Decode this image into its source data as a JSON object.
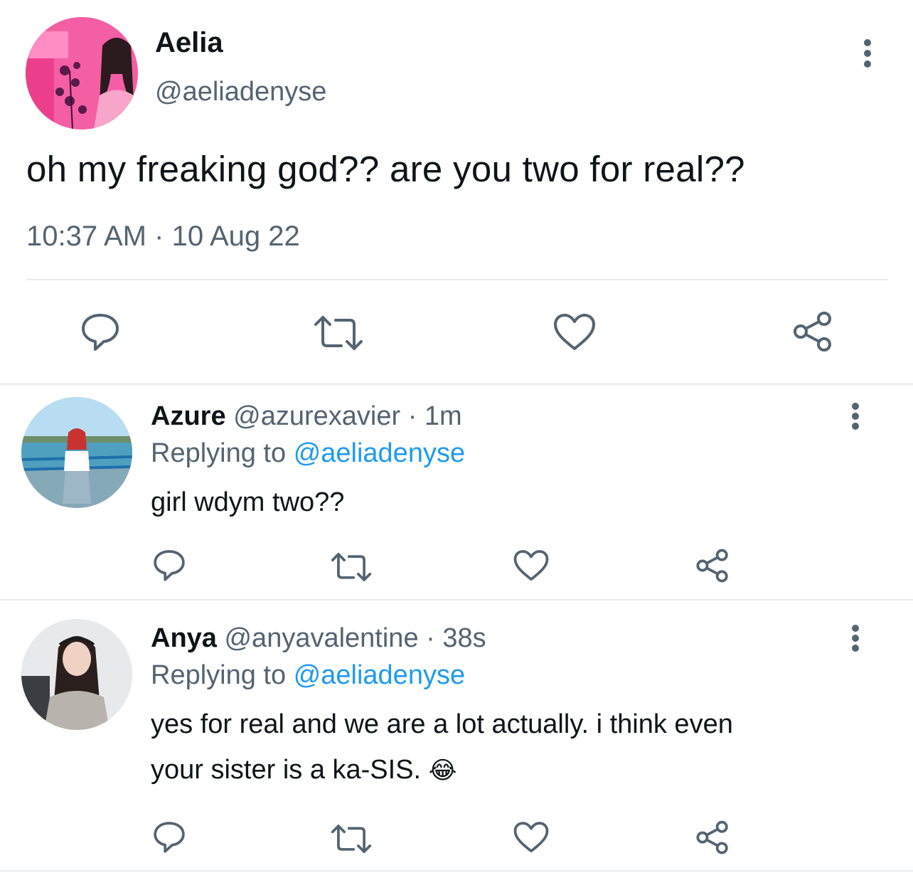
{
  "main_tweet": {
    "name": "Aelia",
    "handle": "@aeliadenyse",
    "text": "oh my freaking god?? are you two for real??",
    "timestamp": "10:37 AM",
    "date": "10 Aug 22",
    "separator": "·"
  },
  "replies": [
    {
      "name": "Azure",
      "handle": "@azurexavier",
      "separator": "·",
      "age": "1m",
      "replying_prefix": "Replying to",
      "replying_handle": "@aeliadenyse",
      "text": "girl wdym two??"
    },
    {
      "name": "Anya",
      "handle": "@anyavalentine",
      "separator": "·",
      "age": "38s",
      "replying_prefix": "Replying to",
      "replying_handle": "@aeliadenyse",
      "text_line1": "yes for real and we are a lot actually. i think even",
      "text_line2": "your sister is a ka-SIS.",
      "emoji": "😂"
    }
  ],
  "icons": {
    "reply": "speech-bubble-icon",
    "retweet": "retweet-arrows-icon",
    "like": "heart-icon",
    "share": "share-nodes-icon",
    "more": "vertical-dots-icon"
  },
  "colors": {
    "text": "#0f1419",
    "muted": "#536471",
    "link": "#1d9bf0",
    "divider": "#e8ebed"
  }
}
